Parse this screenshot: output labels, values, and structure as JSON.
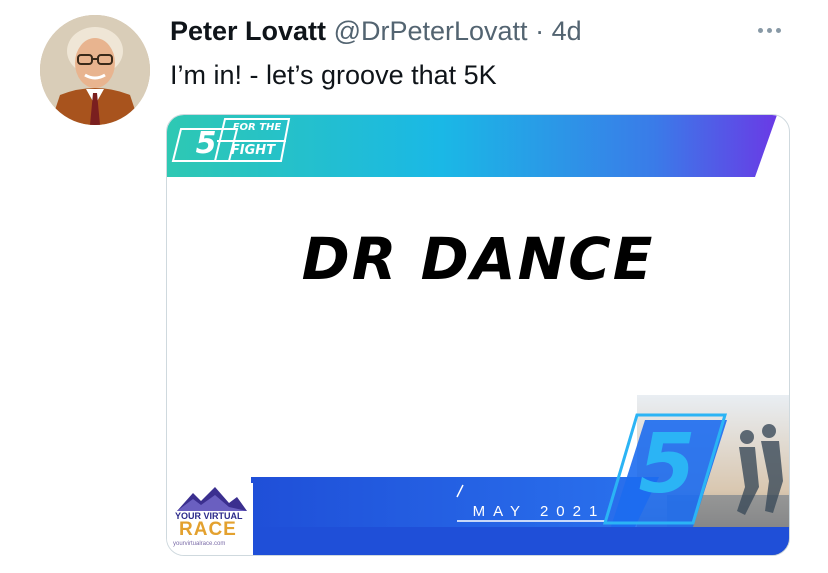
{
  "tweet": {
    "author_name": "Peter Lovatt",
    "handle": "@DrPeterLovatt",
    "separator": "·",
    "time": "4d",
    "text": "I’m in! - let’s groove that 5K",
    "more_icon": "more-horizontal-icon"
  },
  "bib": {
    "logo_number": "5",
    "logo_top": "FOR THE",
    "logo_bottom": "FIGHT",
    "participant_name": "DR DANCE",
    "date_label": "MAY 2021",
    "big_number": "5",
    "sponsor_line1": "YOUR VIRTUAL",
    "sponsor_line2": "RACE",
    "sponsor_url": "yourvirtualrace.com",
    "colors": {
      "teal": "#2ec8b3",
      "cyan": "#1ab8e6",
      "blue": "#1e5fe0",
      "violet": "#6a3ae6"
    }
  }
}
